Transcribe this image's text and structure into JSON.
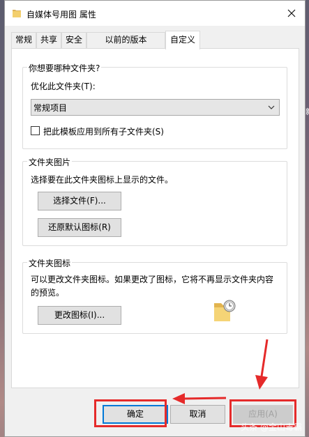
{
  "window": {
    "title": "自媒体号用图 属性"
  },
  "tabs": [
    {
      "label": "常规"
    },
    {
      "label": "共享"
    },
    {
      "label": "安全"
    },
    {
      "label": "以前的版本"
    },
    {
      "label": "自定义"
    }
  ],
  "optimize_group": {
    "title": "你想要哪种文件夹?",
    "label": "优化此文件夹(T):",
    "selected": "常规项目",
    "checkbox_label": "把此模板应用到所有子文件夹(S)"
  },
  "picture_group": {
    "title": "文件夹图片",
    "desc": "选择要在此文件夹图标上显示的文件。",
    "choose_button": "选择文件(F)...",
    "restore_button": "还原默认图标(R)"
  },
  "icon_group": {
    "title": "文件夹图标",
    "desc": "可以更改文件夹图标。如果更改了图标，它将不再显示文件夹内容的预览。",
    "change_button": "更改图标(I)..."
  },
  "footer": {
    "ok": "确定",
    "cancel": "取消",
    "apply": "应用(A)"
  },
  "watermark": "头条 @金山毒霸",
  "colors": {
    "annotation": "#e52a2a",
    "focus": "#0078d7"
  }
}
